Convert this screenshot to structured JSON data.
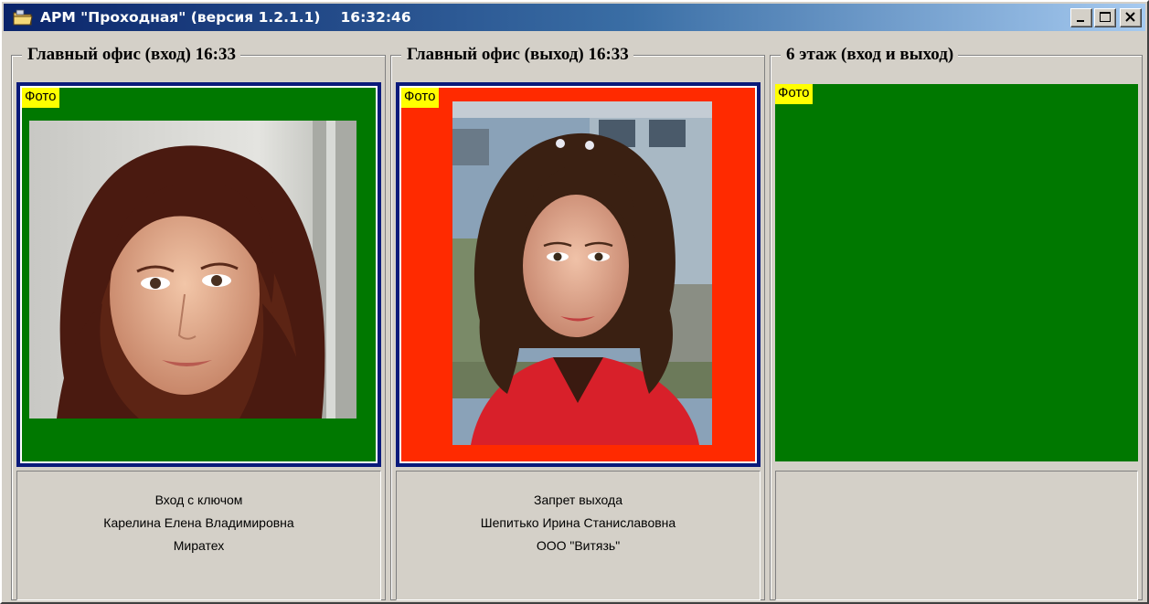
{
  "window": {
    "title": "АРМ \"Проходная\" (версия 1.2.1.1)",
    "time": "16:32:46",
    "icon": "folder-app-icon",
    "buttons": [
      "minimize",
      "maximize",
      "close"
    ]
  },
  "colors": {
    "title_gradient_start": "#0a246a",
    "title_gradient_end": "#a6caf0",
    "allowed": "#007800",
    "denied": "#ff2a00",
    "selected_border": "#0a1a7a",
    "foto_label": "#ffff00"
  },
  "panels": [
    {
      "legend": "Главный офис (вход)  16:33",
      "photo_label": "Фото",
      "status_color": "#007800",
      "selected": true,
      "has_photo": true,
      "event": "Вход с ключом",
      "person": "Карелина Елена Владимировна",
      "company": "Миратех"
    },
    {
      "legend": "Главный офис (выход)  16:33",
      "photo_label": "Фото",
      "status_color": "#ff2a00",
      "selected": true,
      "has_photo": true,
      "event": "Запрет выхода",
      "person": "Шепитько Ирина Станиславовна",
      "company": "ООО \"Витязь\""
    },
    {
      "legend": "6 этаж (вход и выход)",
      "photo_label": "Фото",
      "status_color": "#007800",
      "selected": false,
      "has_photo": false,
      "event": "",
      "person": "",
      "company": ""
    }
  ]
}
